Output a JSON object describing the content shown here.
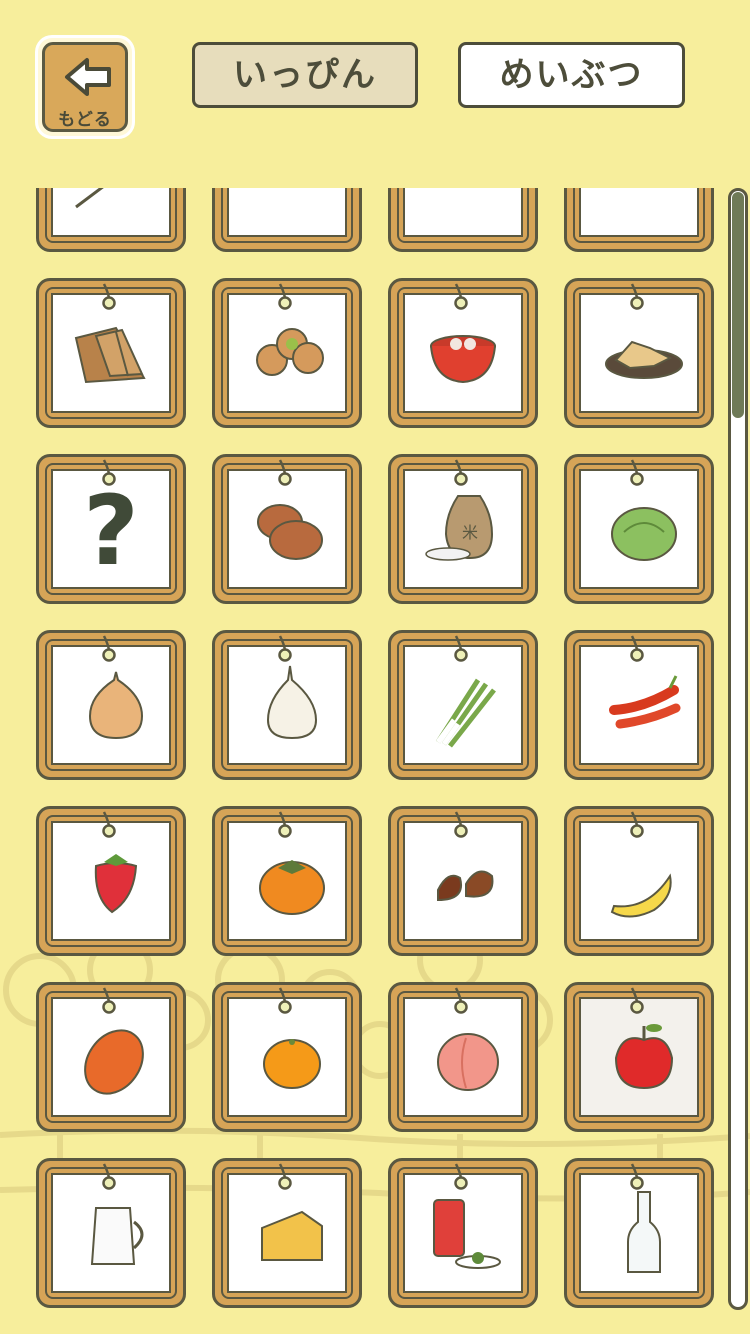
{
  "header": {
    "back_label": "もどる",
    "tabs": [
      {
        "label": "いっぴん",
        "active": true
      },
      {
        "label": "めいぶつ",
        "active": false
      }
    ]
  },
  "colors": {
    "background": "#f7ee9c",
    "frame_wood": "#d6a457",
    "outline": "#5a5841",
    "tab_active": "#e7ddbc"
  },
  "grid": {
    "columns": 4,
    "scroll_position": 0.16,
    "items": [
      {
        "name": "partial-dango-icon",
        "kind": "stick"
      },
      {
        "name": "partial-bread-icon",
        "kind": "bun"
      },
      {
        "name": "partial-tofu-icon",
        "kind": "block"
      },
      {
        "name": "partial-flower-sweets-icon",
        "kind": "flower"
      },
      {
        "name": "senbei-pack-icon",
        "kind": "senbei"
      },
      {
        "name": "manju-icon",
        "kind": "manju"
      },
      {
        "name": "shiratama-bowl-icon",
        "kind": "bowl"
      },
      {
        "name": "karinto-plate-icon",
        "kind": "plate"
      },
      {
        "name": "unknown-question-icon",
        "kind": "question"
      },
      {
        "name": "bread-rolls-icon",
        "kind": "rolls"
      },
      {
        "name": "rice-bag-icon",
        "kind": "ricebag"
      },
      {
        "name": "cabbage-icon",
        "kind": "cabbage"
      },
      {
        "name": "onion-icon",
        "kind": "onion"
      },
      {
        "name": "garlic-icon",
        "kind": "garlic"
      },
      {
        "name": "green-onion-icon",
        "kind": "leek"
      },
      {
        "name": "chili-pepper-icon",
        "kind": "chili"
      },
      {
        "name": "strawberry-icon",
        "kind": "strawberry"
      },
      {
        "name": "persimmon-icon",
        "kind": "persimmon"
      },
      {
        "name": "chestnut-icon",
        "kind": "chestnut"
      },
      {
        "name": "banana-icon",
        "kind": "banana"
      },
      {
        "name": "mango-icon",
        "kind": "mango"
      },
      {
        "name": "mikan-icon",
        "kind": "mikan"
      },
      {
        "name": "peach-icon",
        "kind": "peach"
      },
      {
        "name": "apple-icon",
        "kind": "apple",
        "selected": true
      },
      {
        "name": "milk-jug-icon",
        "kind": "milk"
      },
      {
        "name": "cheese-icon",
        "kind": "cheese"
      },
      {
        "name": "tea-can-icon",
        "kind": "teacan"
      },
      {
        "name": "glass-bottle-icon",
        "kind": "bottle"
      }
    ]
  }
}
